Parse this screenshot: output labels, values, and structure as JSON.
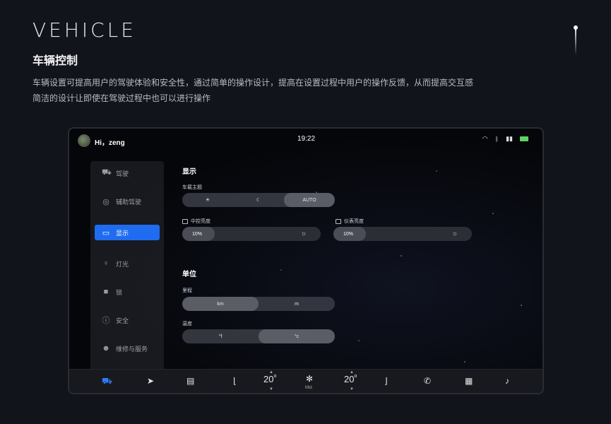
{
  "page": {
    "title_en": "VEHICLE",
    "title_cn": "车辆控制",
    "description_line1": "车辆设置可提高用户的驾驶体验和安全性，通过简单的操作设计，提高在设置过程中用户的操作反馈，从而提高交互感",
    "description_line2": "简洁的设计让即使在驾驶过程中也可以进行操作"
  },
  "status": {
    "greeting": "Hi，zeng",
    "time": "19:22",
    "icons": [
      "wifi-icon",
      "bluetooth-icon",
      "signal-icon",
      "battery-icon"
    ]
  },
  "sidebar": {
    "items": [
      {
        "label": "驾驶",
        "icon": "car-icon",
        "glyph": "🚘"
      },
      {
        "label": "辅助驾驶",
        "icon": "steering-wheel-icon",
        "glyph": "◎"
      },
      {
        "label": "显示",
        "icon": "display-icon",
        "glyph": "▭",
        "active": true
      },
      {
        "label": "灯光",
        "icon": "bulb-icon",
        "glyph": "♀"
      },
      {
        "label": "锁",
        "icon": "lock-icon",
        "glyph": "🔒"
      },
      {
        "label": "安全",
        "icon": "alert-icon",
        "glyph": "ⓘ"
      },
      {
        "label": "维修与服务",
        "icon": "service-icon",
        "glyph": "👤"
      }
    ]
  },
  "display": {
    "section_title": "显示",
    "theme_label": "车载主题",
    "theme_options": [
      "☀",
      "☾",
      "AUTO"
    ],
    "theme_selected": "AUTO",
    "center_label": "中控亮度",
    "center_value": "10%",
    "center_level": 0.1,
    "dash_label": "仪表亮度",
    "dash_value": "10%",
    "dash_level": 0.1
  },
  "units": {
    "section_title": "单位",
    "distance_label": "里程",
    "distance_options": [
      "km",
      "m"
    ],
    "distance_selected": "km",
    "temp_label": "温度",
    "temp_options": [
      "°f",
      "°c"
    ],
    "temp_selected": "°c"
  },
  "dock": {
    "left_temp": "20",
    "right_temp": "20",
    "degree": "o",
    "fan_caption": "Mid",
    "active_color": "#2f7bff"
  }
}
